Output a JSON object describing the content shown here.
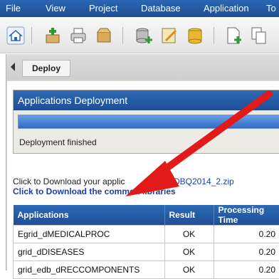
{
  "menu": {
    "items": [
      "File",
      "View",
      "Project",
      "Database",
      "Application",
      "To"
    ]
  },
  "toolbar": {
    "icons": [
      "home-icon",
      "add-icon",
      "print-icon",
      "box-icon",
      "database-add-icon",
      "edit-icon",
      "database-icon",
      "new-doc-icon",
      "copy-icon"
    ]
  },
  "tabs": {
    "deploy": "Deploy"
  },
  "deployment": {
    "title": "Applications Deployment",
    "progress_fraction": 1.0,
    "status": "Deployment finished"
  },
  "downloads": {
    "app_text": "Click to Download your applic",
    "app_file": "EDBQ2014_2.zip",
    "libs_text": "Click to Download the common libraries"
  },
  "table": {
    "headers": [
      "Applications",
      "Result",
      "Processing Time"
    ],
    "rows": [
      {
        "app": "Egrid_dMEDICALPROC",
        "result": "OK",
        "time": "0.20"
      },
      {
        "app": "grid_dDISEASES",
        "result": "OK",
        "time": "0.20"
      },
      {
        "app": "grid_edb_dRECCOMPONENTS",
        "result": "OK",
        "time": "0.20"
      }
    ]
  },
  "colors": {
    "menubar": "#1d4f93",
    "header": "#2d69b6",
    "link": "#1a3fa8",
    "arrow": "#e21a1a"
  }
}
